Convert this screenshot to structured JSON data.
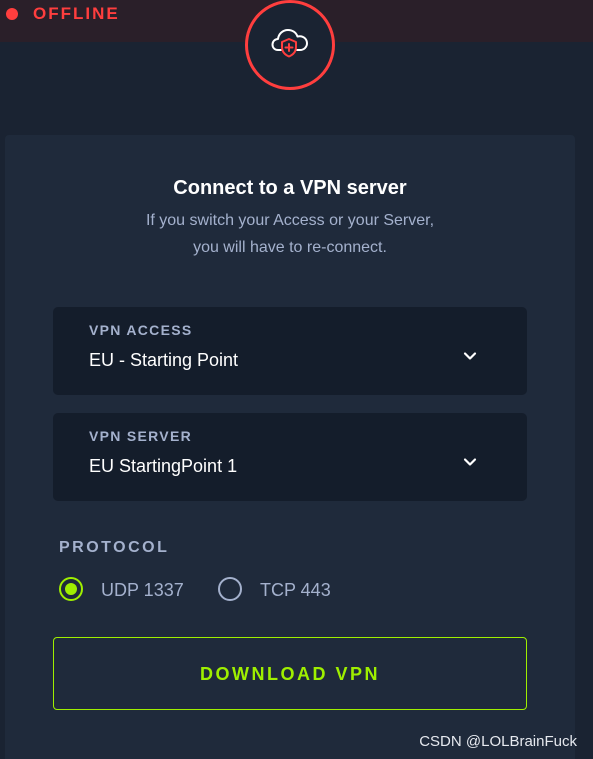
{
  "status": {
    "text": "OFFLINE",
    "color": "#ff3e3e"
  },
  "badge": {
    "icon": "cloud-shield-icon"
  },
  "panel": {
    "title": "Connect to a VPN server",
    "subtitle_line1": "If you switch your Access or your Server,",
    "subtitle_line2": "you will have to re-connect."
  },
  "vpn_access": {
    "label": "VPN ACCESS",
    "value": "EU - Starting Point",
    "icon": "chevron-down-icon"
  },
  "vpn_server": {
    "label": "VPN SERVER",
    "value": "EU StartingPoint 1",
    "icon": "chevron-down-icon"
  },
  "protocol": {
    "label": "PROTOCOL",
    "options": [
      {
        "label": "UDP 1337",
        "selected": true
      },
      {
        "label": "TCP 443",
        "selected": false
      }
    ]
  },
  "download": {
    "label": "DOWNLOAD VPN"
  },
  "watermark": "CSDN @LOLBrainFuck",
  "colors": {
    "background": "#1a2332",
    "panel": "#1f2a3b",
    "field": "#141d2b",
    "accent": "#9fef00",
    "alert": "#ff3e3e",
    "muted_text": "#a4b1cd"
  }
}
